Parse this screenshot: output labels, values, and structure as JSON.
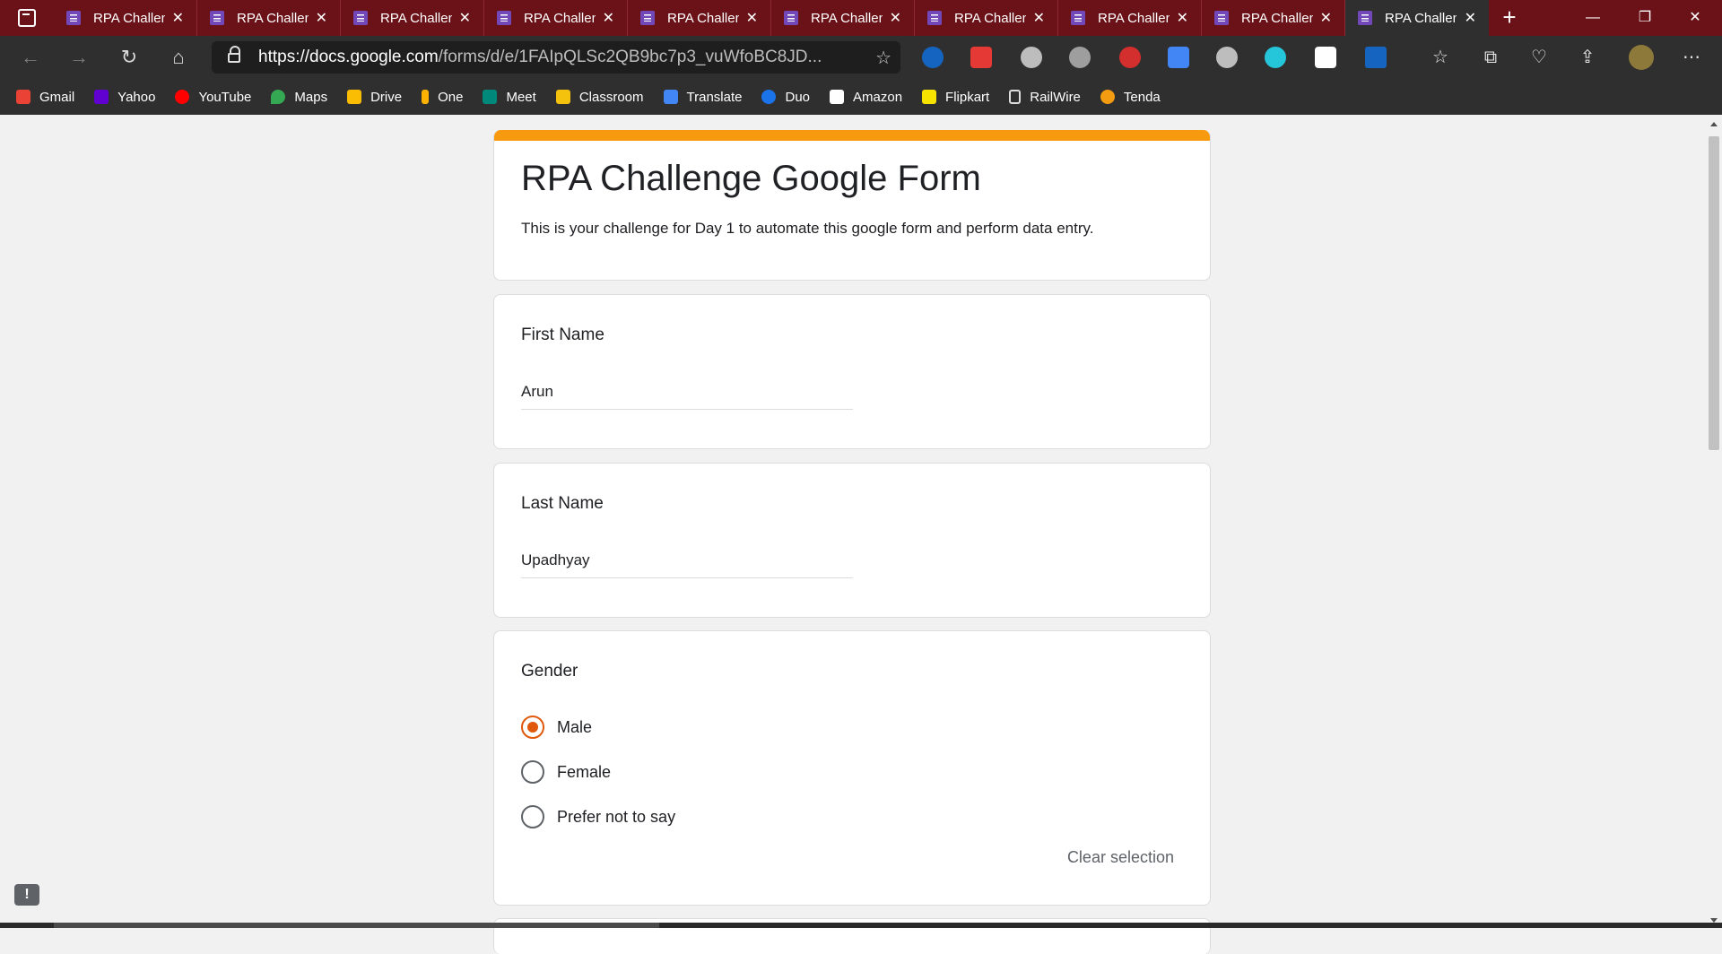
{
  "browser": {
    "tabs": [
      {
        "title": "RPA Challenge Google Form"
      },
      {
        "title": "RPA Challenge Google Form"
      },
      {
        "title": "RPA Challenge Google Form"
      },
      {
        "title": "RPA Challenge Google Form"
      },
      {
        "title": "RPA Challenge Google Form"
      },
      {
        "title": "RPA Challenge Google Form"
      },
      {
        "title": "RPA Challenge Google Form"
      },
      {
        "title": "RPA Challenge Google Form"
      },
      {
        "title": "RPA Challenge Google Form"
      },
      {
        "title": "RPA Challenge Google Form"
      }
    ],
    "active_tab_index": 9,
    "url_host": "https://docs.google.com",
    "url_rest": "/forms/d/e/1FAIpQLSc2QB9bc7p3_vuWfoBC8JD...",
    "bookmarks": [
      {
        "label": "Gmail",
        "color": "#ea4335"
      },
      {
        "label": "Yahoo",
        "color": "#6001d2"
      },
      {
        "label": "YouTube",
        "color": "#ff0000"
      },
      {
        "label": "Maps",
        "color": "#34a853"
      },
      {
        "label": "Drive",
        "color": "#fbbc04"
      },
      {
        "label": "One",
        "color": "#ffb300"
      },
      {
        "label": "Meet",
        "color": "#00897b"
      },
      {
        "label": "Classroom",
        "color": "#f4c20d"
      },
      {
        "label": "Translate",
        "color": "#4285f4"
      },
      {
        "label": "Duo",
        "color": "#1a73e8"
      },
      {
        "label": "Amazon",
        "color": "#ffffff"
      },
      {
        "label": "Flipkart",
        "color": "#f7e300"
      },
      {
        "label": "RailWire",
        "color": "#dddddd"
      },
      {
        "label": "Tenda",
        "color": "#f39c12"
      }
    ]
  },
  "form": {
    "title": "RPA Challenge Google Form",
    "description": "This is your challenge for Day 1 to automate this google form and perform data entry.",
    "accent_color": "#f79a0f",
    "first_name": {
      "label": "First Name",
      "value": "Arun"
    },
    "last_name": {
      "label": "Last Name",
      "value": "Upadhyay"
    },
    "gender": {
      "label": "Gender",
      "options": [
        {
          "label": "Male",
          "checked": true
        },
        {
          "label": "Female",
          "checked": false
        },
        {
          "label": "Prefer not to say",
          "checked": false
        }
      ],
      "clear_label": "Clear selection"
    }
  },
  "feedback_icon": "!"
}
